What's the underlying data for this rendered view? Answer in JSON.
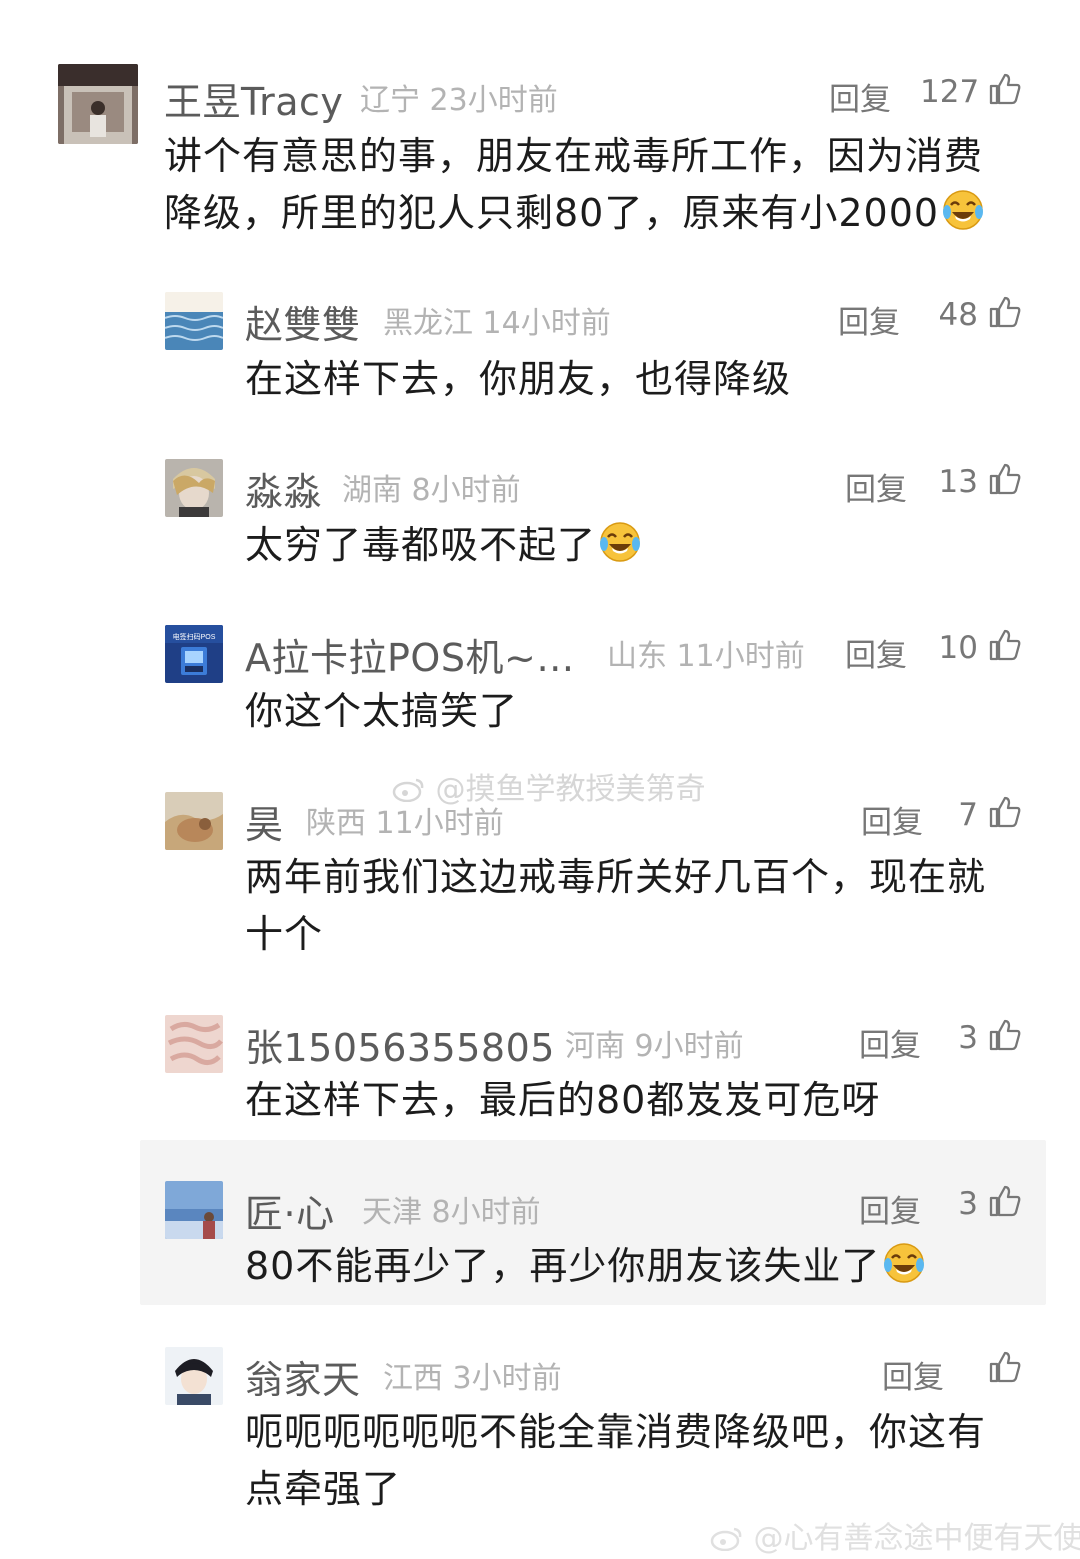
{
  "reply_label": "回复",
  "comments": [
    {
      "name": "王昱Tracy",
      "location": "辽宁",
      "time": "23小时前",
      "likes": "127",
      "lines": [
        "讲个有意思的事，朋友在戒毒所工作，因为消费",
        "降级，所里的犯人只剩80了，原来有小2000"
      ],
      "emoji_after_last_line": true
    },
    {
      "name": "赵雙雙",
      "location": "黑龙江",
      "time": "14小时前",
      "likes": "48",
      "lines": [
        "在这样下去，你朋友，也得降级"
      ]
    },
    {
      "name": "淼淼",
      "location": "湖南",
      "time": "8小时前",
      "likes": "13",
      "lines": [
        "太穷了毒都吸不起了"
      ],
      "emoji_after_last_line": true
    },
    {
      "name": "A拉卡拉POS机~…",
      "location": "山东",
      "time": "11小时前",
      "likes": "10",
      "lines": [
        "你这个太搞笑了"
      ],
      "avatar_text": "电签扫码POS"
    },
    {
      "name": "昊",
      "location": "陕西",
      "time": "11小时前",
      "likes": "7",
      "lines": [
        "两年前我们这边戒毒所关好几百个，现在就",
        "十个"
      ]
    },
    {
      "name": "张15056355805",
      "location": "河南",
      "time": "9小时前",
      "likes": "3",
      "lines": [
        "在这样下去，最后的80都岌岌可危呀"
      ]
    },
    {
      "name": "匠·心",
      "location": "天津",
      "time": "8小时前",
      "likes": "3",
      "lines": [
        "80不能再少了，再少你朋友该失业了"
      ],
      "emoji_after_last_line": true
    },
    {
      "name": "翁家天",
      "location": "江西",
      "time": "3小时前",
      "likes": "",
      "lines": [
        "呃呃呃呃呃呃不能全靠消费降级吧，你这有",
        "点牵强了"
      ]
    }
  ],
  "watermarks": {
    "middle": "@摸鱼学教授美第奇",
    "bottom": "@心有善念途中便有天使"
  },
  "colors": {
    "name": "#5b5b5b",
    "meta": "#b3b3b3",
    "text": "#1c1c1c",
    "highlight": "#f4f4f4"
  }
}
